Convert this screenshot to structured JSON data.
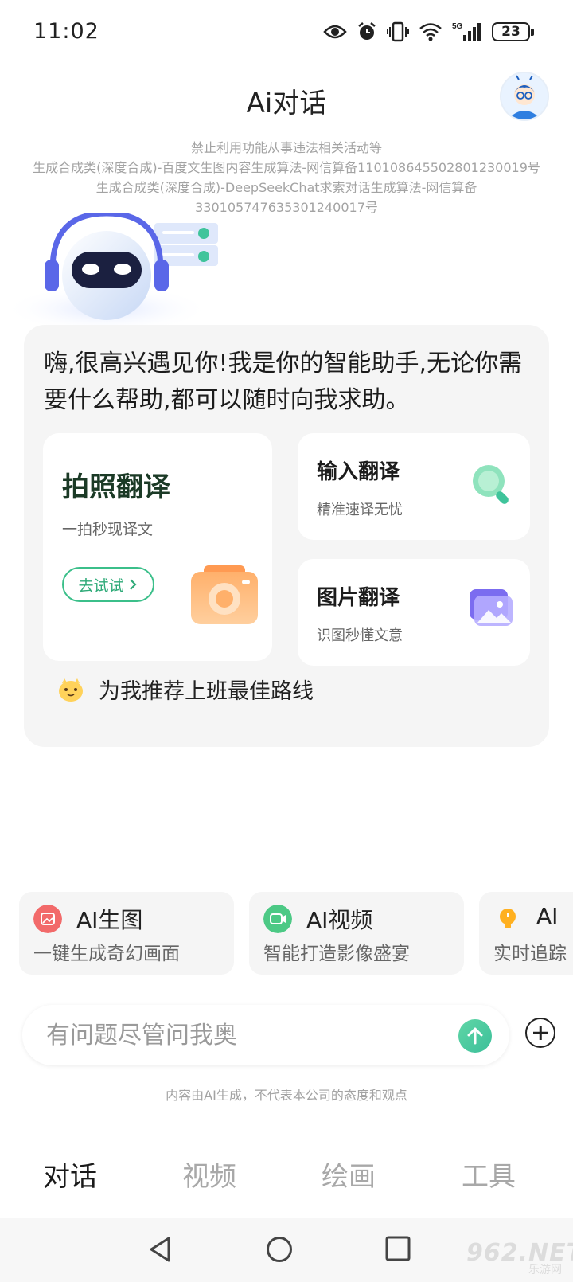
{
  "status_bar": {
    "time": "11:02",
    "network": "5G",
    "battery": "23"
  },
  "header": {
    "title": "Ai对话"
  },
  "notice": {
    "lines": [
      "禁止利用功能从事违法相关活动等",
      "生成合成类(深度合成)-百度文生图内容生成算法-网信算备110108645502801230019号",
      "生成合成类(深度合成)-DeepSeekChat求索对话生成算法-网信算备",
      "330105747635301240017号"
    ]
  },
  "card": {
    "greeting": "嗨,很高兴遇见你!我是你的智能助手,无论你需要什么帮助,都可以随时向我求助。",
    "photo_translate": {
      "title": "拍照翻译",
      "subtitle": "一拍秒现译文",
      "button": "去试试",
      "icon": "camera-icon"
    },
    "input_translate": {
      "title": "输入翻译",
      "subtitle": "精准速译无忧",
      "icon": "magnifier-icon"
    },
    "image_translate": {
      "title": "图片翻译",
      "subtitle": "识图秒懂文意",
      "icon": "picture-icon"
    },
    "suggestion": "为我推荐上班最佳路线"
  },
  "features": [
    {
      "title": "AI生图",
      "subtitle": "一键生成奇幻画面",
      "icon": "image-gen-icon",
      "color": "#f26a6a"
    },
    {
      "title": "AI视频",
      "subtitle": "智能打造影像盛宴",
      "icon": "video-icon",
      "color": "#4cc985"
    },
    {
      "title": "AI",
      "subtitle": "实时追踪",
      "icon": "bulb-icon",
      "color": "#ffb020"
    }
  ],
  "input": {
    "placeholder": "有问题尽管问我奥"
  },
  "disclaimer": "内容由AI生成，不代表本公司的态度和观点",
  "tabs": [
    {
      "label": "对话",
      "active": true
    },
    {
      "label": "视频",
      "active": false
    },
    {
      "label": "绘画",
      "active": false
    },
    {
      "label": "工具",
      "active": false
    }
  ],
  "watermark": {
    "text": "962.NET",
    "sub": "乐游网"
  },
  "colors": {
    "accent_green": "#3bbf8a",
    "card_bg": "#f5f5f5"
  }
}
